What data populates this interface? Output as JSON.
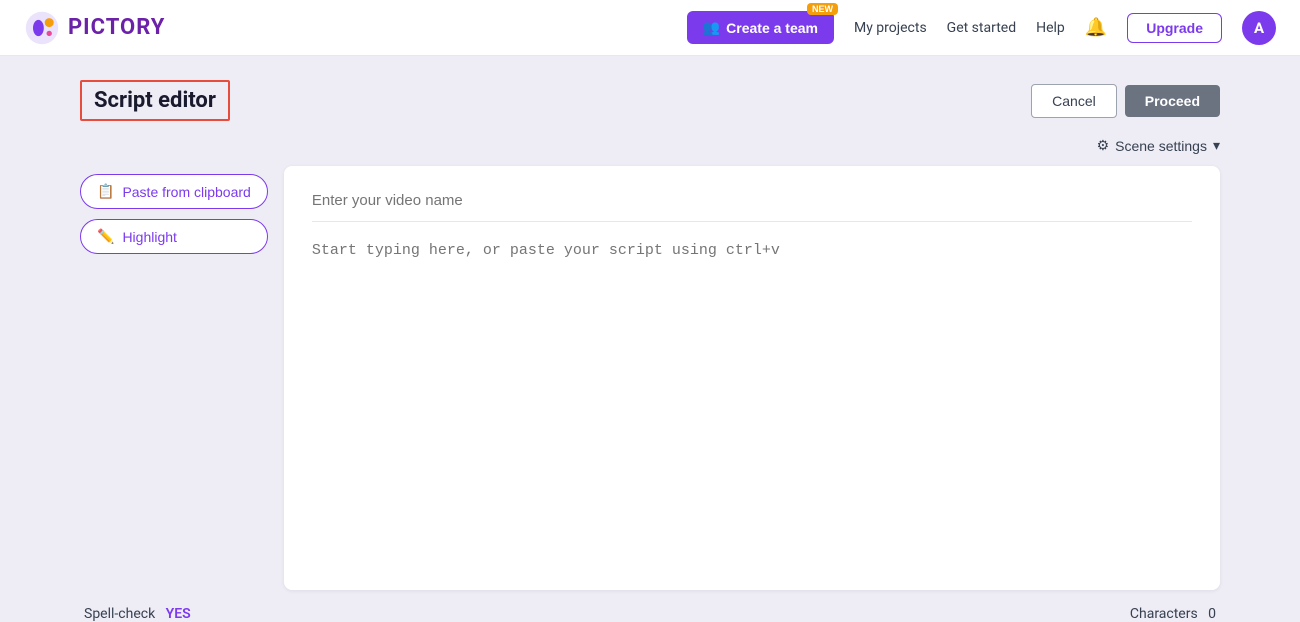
{
  "navbar": {
    "logo_text": "PICTORY",
    "create_team_label": "Create a team",
    "new_badge": "NEW",
    "team_icon": "👥",
    "my_projects": "My projects",
    "get_started": "Get started",
    "help": "Help",
    "upgrade_label": "Upgrade",
    "avatar_letter": "A"
  },
  "header": {
    "title": "Script editor",
    "cancel_label": "Cancel",
    "proceed_label": "Proceed"
  },
  "scene_settings": {
    "label": "Scene settings",
    "gear_icon": "⚙",
    "chevron_icon": "▾"
  },
  "sidebar": {
    "paste_label": "Paste from clipboard",
    "paste_icon": "📋",
    "highlight_label": "Highlight",
    "highlight_icon": "✏️"
  },
  "editor": {
    "video_name_placeholder": "Enter your video name",
    "script_placeholder": "Start typing here, or paste your script using ctrl+v"
  },
  "footer": {
    "spell_check_label": "Spell-check",
    "spell_check_value": "YES",
    "characters_label": "Characters",
    "characters_count": "0"
  }
}
